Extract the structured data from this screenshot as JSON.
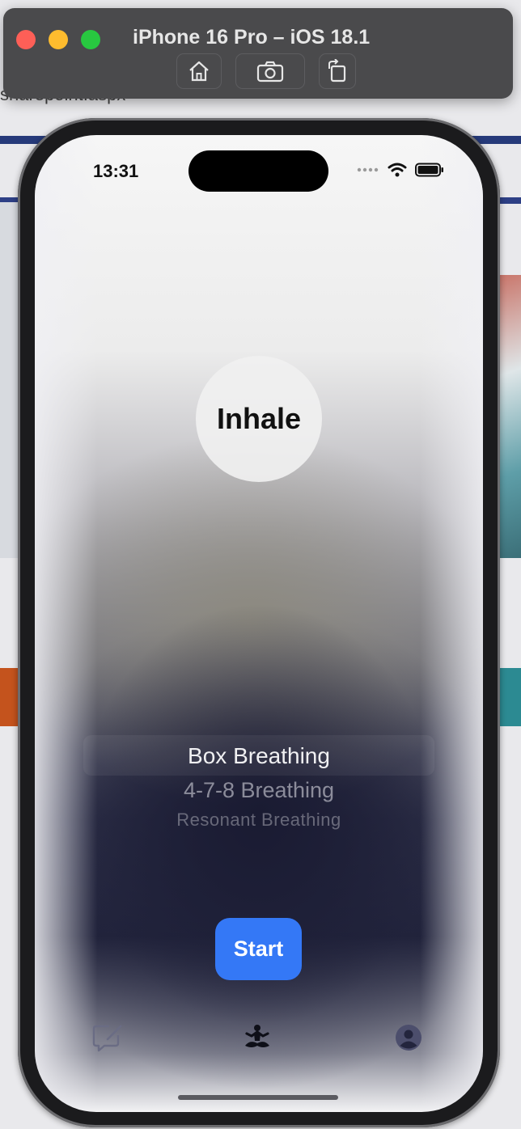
{
  "simulator": {
    "title": "iPhone 16 Pro – iOS 18.1",
    "toolbar": [
      "home-icon",
      "screenshot-icon",
      "rotate-icon"
    ]
  },
  "background_page": {
    "url_fragment": "sharepoint.aspx"
  },
  "phone": {
    "status_bar": {
      "time": "13:31"
    },
    "breath_phase": "Inhale",
    "picker": {
      "options": [
        "Box Breathing",
        "4-7-8 Breathing",
        "Resonant Breathing"
      ],
      "selected": "Box Breathing"
    },
    "start_label": "Start",
    "tab_bar": {
      "items": [
        {
          "icon": "journal-edit-icon",
          "active": false
        },
        {
          "icon": "meditation-icon",
          "active": true
        },
        {
          "icon": "profile-icon",
          "active": false
        }
      ]
    }
  },
  "colors": {
    "accent": "#3478f6",
    "simulator_chrome": "#4a4a4c"
  }
}
